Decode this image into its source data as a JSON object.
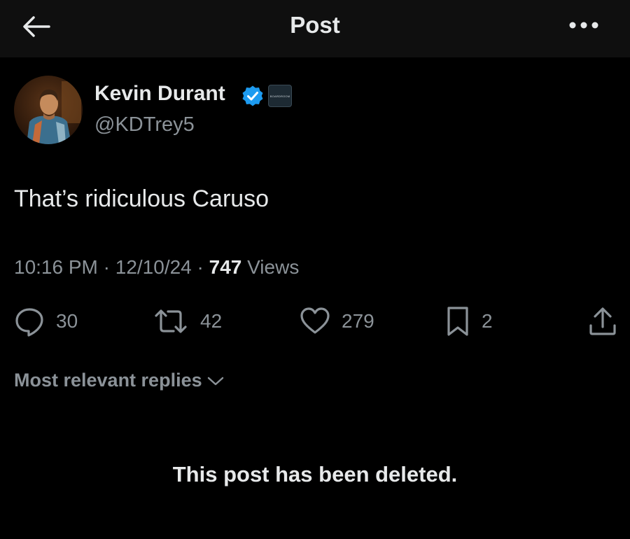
{
  "header": {
    "title": "Post",
    "back_icon": "arrow-left-icon",
    "more_icon": "more-horizontal-icon"
  },
  "author": {
    "name": "Kevin Durant",
    "handle": "@KDTrey5",
    "verified_color": "#1d9bf0",
    "affiliate_badge_text": "BOARDROOM"
  },
  "tweet": {
    "text": "That’s ridiculous Caruso",
    "time": "10:16 PM",
    "date": "12/10/24",
    "separator": "·",
    "views_count": "747",
    "views_label": "Views"
  },
  "actions": {
    "replies": "30",
    "reposts": "42",
    "likes": "279",
    "bookmarks": "2"
  },
  "replies_sort": {
    "label": "Most relevant replies"
  },
  "reply_notice": "This post has been deleted.",
  "colors": {
    "background": "#000000",
    "header_bg": "#0f0f0f",
    "primary_text": "#e7e9ea",
    "secondary_text": "#8b9298",
    "accent": "#1d9bf0"
  }
}
